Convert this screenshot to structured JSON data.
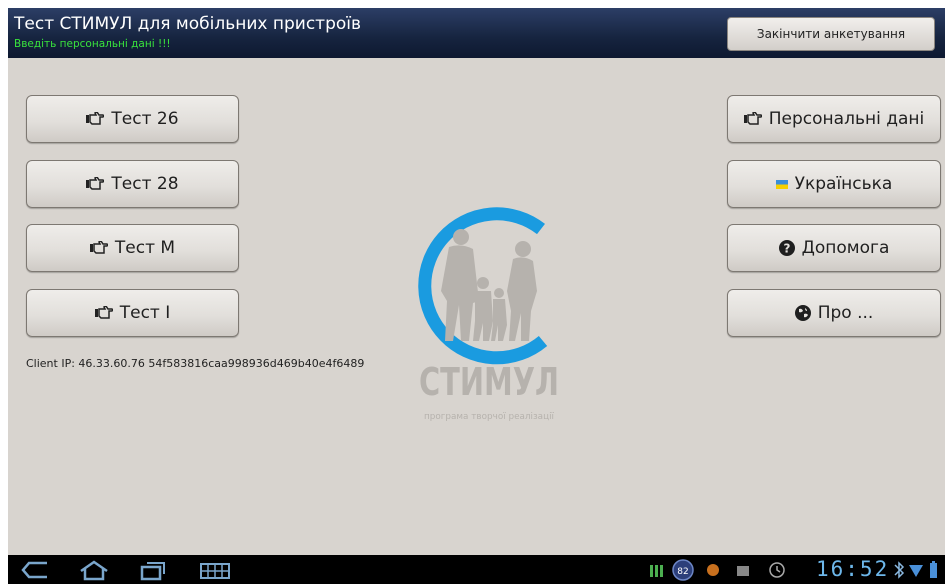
{
  "header": {
    "title": "Тест СТИМУЛ для мобільних пристроїв",
    "subtitle": "Введіть персональні дані !!!",
    "finish_button": "Закінчити анкетування"
  },
  "left_buttons": [
    {
      "label": "Тест 26",
      "icon": "pointing-hand-icon"
    },
    {
      "label": "Тест 28",
      "icon": "pointing-hand-icon"
    },
    {
      "label": "Тест М",
      "icon": "pointing-hand-icon"
    },
    {
      "label": "Тест І",
      "icon": "pointing-hand-icon"
    }
  ],
  "right_buttons": [
    {
      "label": "Персональні дані",
      "icon": "pointing-hand-icon"
    },
    {
      "label": "Українська",
      "icon": "ukraine-flag-icon"
    },
    {
      "label": "Допомога",
      "icon": "help-circle-icon"
    },
    {
      "label": "Про ...",
      "icon": "globe-icon"
    }
  ],
  "client_info": "Client IP: 46.33.60.76 54f583816caa998936d469b40e4f6489",
  "logo": {
    "word": "СТИМУЛ",
    "tagline": "програма творчої реалізації",
    "accent_color": "#1a9be0"
  },
  "status_bar": {
    "time": "16:52",
    "battery_badge": "82"
  },
  "colors": {
    "header_bg": "#16243f",
    "subtitle": "#39e33d",
    "screen_bg": "#d8d4cf",
    "clock": "#6db7ea"
  }
}
